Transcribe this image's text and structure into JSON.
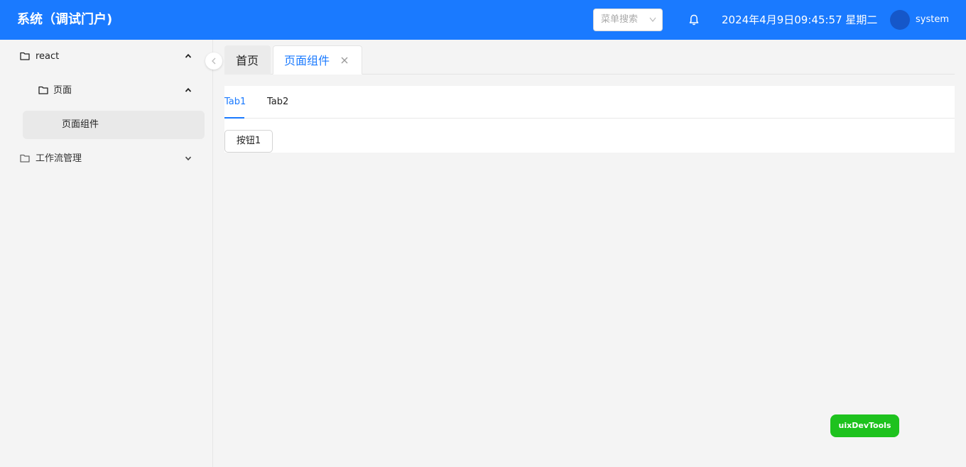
{
  "header": {
    "title": "系统（调试门户)",
    "search_placeholder": "菜单搜索",
    "datetime": "2024年4月9日09:45:57 星期二",
    "username": "system",
    "accent_color": "#1a7aff"
  },
  "sidebar": {
    "items": [
      {
        "label": "react",
        "icon": "folder-icon",
        "expanded": true,
        "level": 1
      },
      {
        "label": "页面",
        "icon": "folder-icon",
        "expanded": true,
        "level": 2
      },
      {
        "label": "页面组件",
        "active": true,
        "level": 3
      },
      {
        "label": "工作流管理",
        "icon": "folder-icon",
        "expanded": false,
        "level": 1
      }
    ]
  },
  "page_tabs": [
    {
      "label": "首页"
    },
    {
      "label": "页面组件",
      "active": true,
      "closable": true
    }
  ],
  "content": {
    "tabs": [
      {
        "label": "Tab1",
        "active": true
      },
      {
        "label": "Tab2"
      }
    ],
    "button_label": "按钮1"
  },
  "devtools_label": "uixDevTools"
}
